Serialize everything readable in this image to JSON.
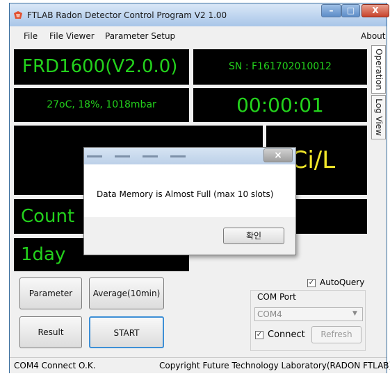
{
  "window": {
    "title": "FTLAB Radon Detector Control Program V2 1.00",
    "controls": {
      "minimize": "–",
      "maximize": "□",
      "close": "X"
    }
  },
  "menu": {
    "file": "File",
    "file_viewer": "File Viewer",
    "parameter_setup": "Parameter Setup",
    "about": "About"
  },
  "tabs": {
    "operation": "Operation",
    "log_view": "Log View"
  },
  "display": {
    "model": "FRD1600(V2.0.0)",
    "serial": "SN : F161702010012",
    "env": "27oC, 18%, 1018mbar",
    "timer": "00:00:01",
    "unit": "pCi/L",
    "count_label": "Count",
    "count_value": "----",
    "day_label": "1day"
  },
  "buttons": {
    "parameter": "Parameter",
    "average": "Average(10min)",
    "result": "Result",
    "start": "START"
  },
  "com": {
    "autoquery_label": "AutoQuery",
    "autoquery_checked": "✓",
    "group_label": "COM Port",
    "port_value": "COM4",
    "connect_label": "Connect",
    "connect_checked": "✓",
    "refresh_label": "Refresh"
  },
  "status": {
    "left": "COM4 Connect O.K.",
    "right": "Copyright Future Technology Laboratory(RADON FTLAB)"
  },
  "dialog": {
    "message": "Data Memory is Almost Full (max 10 slots)",
    "ok_label": "확인",
    "close_glyph": "×"
  },
  "colors": {
    "panel_bg": "#000000",
    "green": "#23d11c",
    "yellow": "#f2e82a"
  }
}
